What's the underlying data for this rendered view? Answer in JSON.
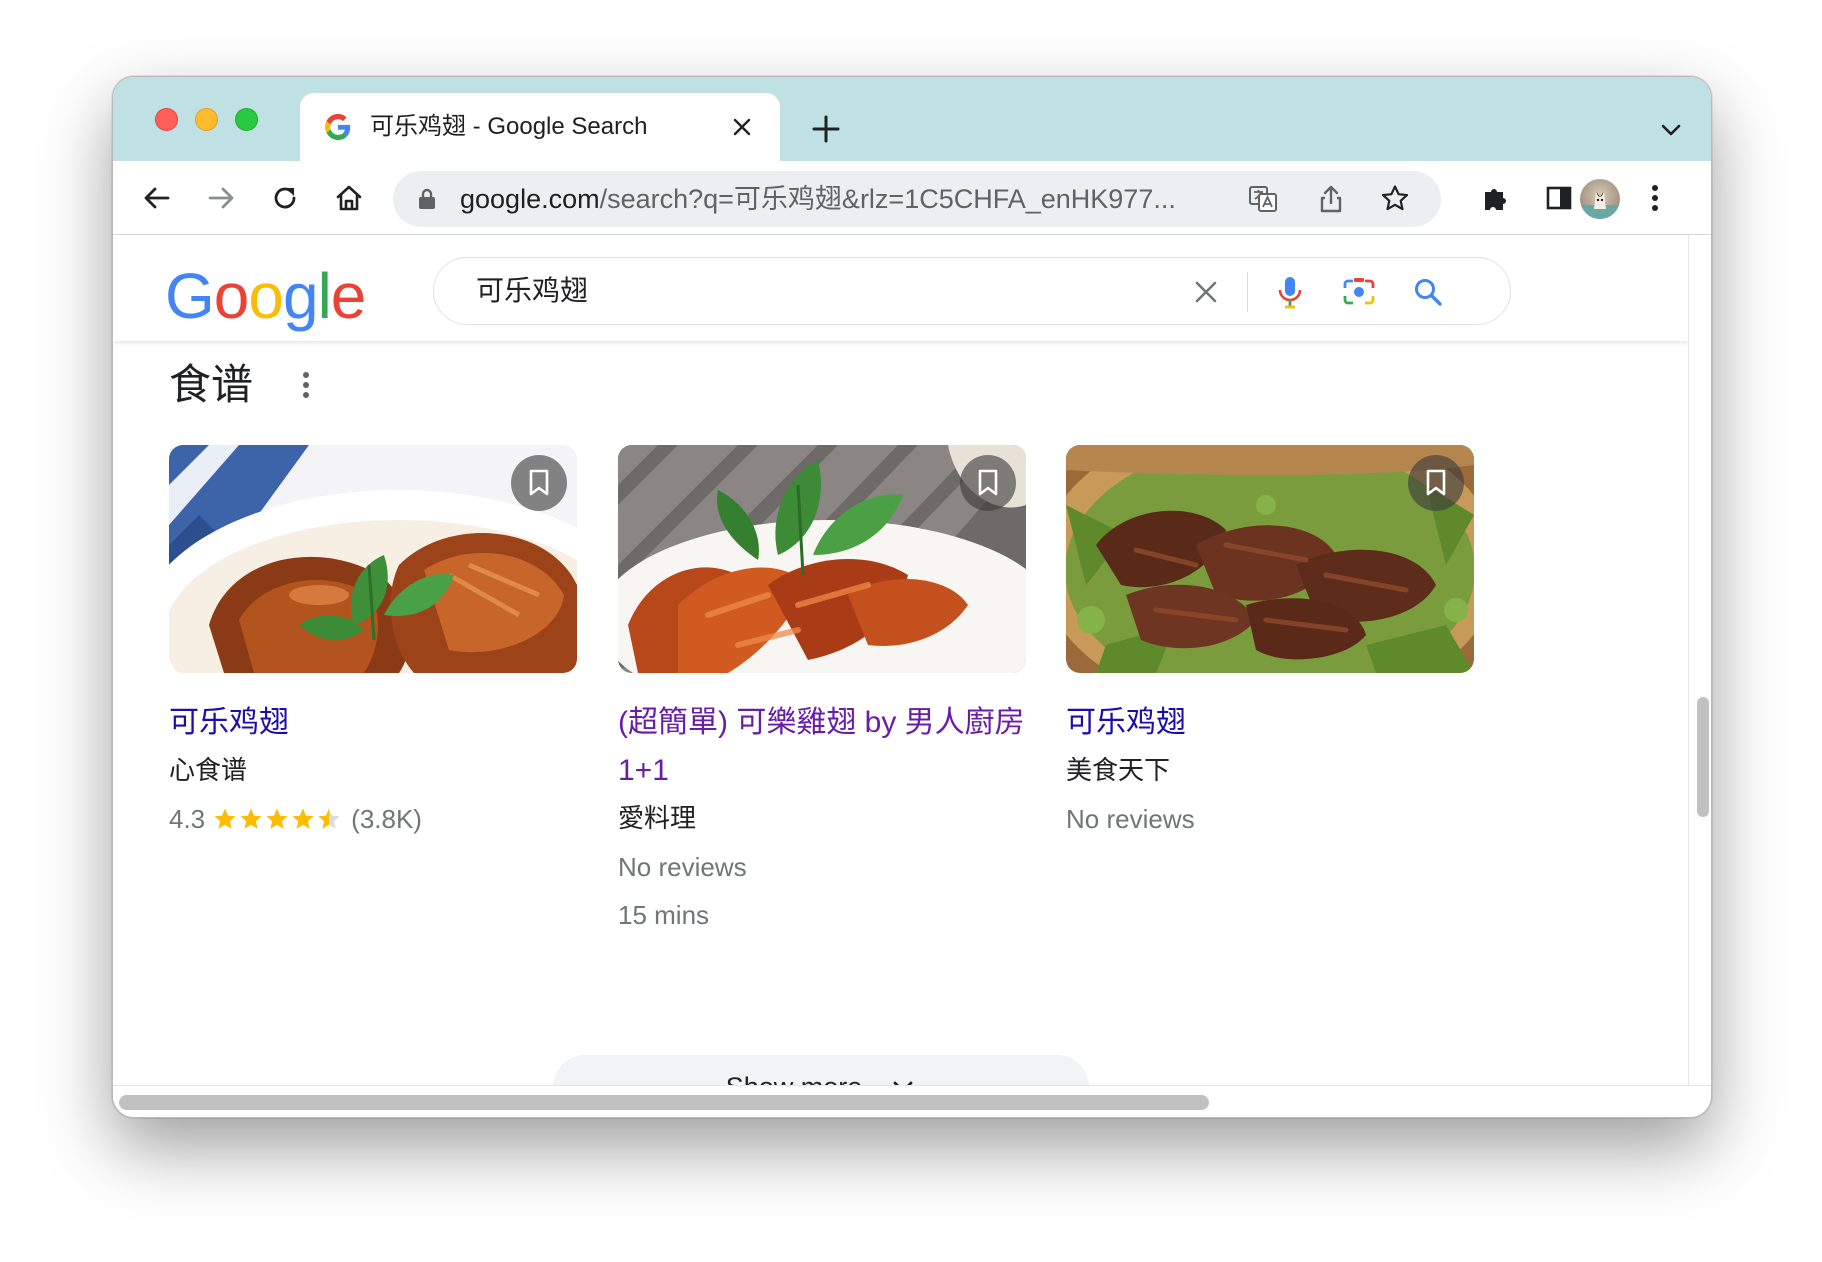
{
  "browser": {
    "tab_title": "可乐鸡翅 - Google Search",
    "url_host": "google.com",
    "url_rest": "/search?q=可乐鸡翅&rlz=1C5CHFA_enHK977..."
  },
  "search": {
    "query": "可乐鸡翅",
    "logo_letters": [
      {
        "ch": "G",
        "color": "#4285F4"
      },
      {
        "ch": "o",
        "color": "#EA4335"
      },
      {
        "ch": "o",
        "color": "#FBBC05"
      },
      {
        "ch": "g",
        "color": "#4285F4"
      },
      {
        "ch": "l",
        "color": "#34A853"
      },
      {
        "ch": "e",
        "color": "#EA4335"
      }
    ]
  },
  "recipes": {
    "section_title": "食谱",
    "cards": [
      {
        "title": "可乐鸡翅",
        "source": "心食谱",
        "rating": "4.3",
        "rating_value": 4.3,
        "review_count": "(3.8K)",
        "extra": ""
      },
      {
        "title": "(超簡單) 可樂雞翅 by 男人廚房1+1",
        "source": "愛料理",
        "reviews": "No reviews",
        "extra": "15 mins"
      },
      {
        "title": "可乐鸡翅",
        "source": "美食天下",
        "reviews": "No reviews",
        "extra": ""
      }
    ],
    "show_more": "Show more"
  },
  "colors": {
    "tabbar": "#bfe1e3",
    "link": "#1a0dab",
    "visited_link": "#681da8",
    "star": "#fbbc04"
  }
}
